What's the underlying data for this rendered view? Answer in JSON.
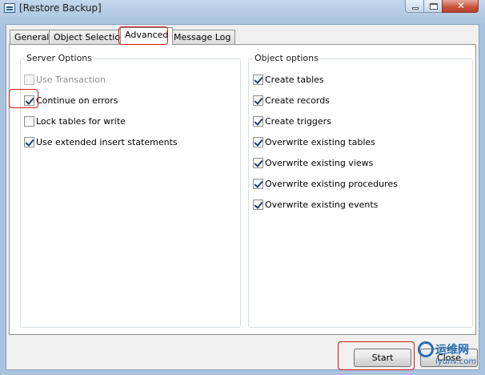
{
  "window": {
    "title": "[Restore Backup]",
    "close_glyph": "✕"
  },
  "tabs": [
    {
      "label": "General"
    },
    {
      "label": "Object Selection"
    },
    {
      "label": "Advanced"
    },
    {
      "label": "Message Log"
    }
  ],
  "server_options": {
    "title": "Server Options",
    "items": [
      {
        "label": "Use Transaction",
        "checked": false,
        "enabled": false
      },
      {
        "label": "Continue on errors",
        "checked": true,
        "enabled": true
      },
      {
        "label": "Lock tables for write",
        "checked": false,
        "enabled": true
      },
      {
        "label": "Use extended insert statements",
        "checked": true,
        "enabled": true
      }
    ]
  },
  "object_options": {
    "title": "Object options",
    "items": [
      {
        "label": "Create tables",
        "checked": true
      },
      {
        "label": "Create records",
        "checked": true
      },
      {
        "label": "Create triggers",
        "checked": true
      },
      {
        "label": "Overwrite existing tables",
        "checked": true
      },
      {
        "label": "Overwrite existing views",
        "checked": true
      },
      {
        "label": "Overwrite existing procedures",
        "checked": true
      },
      {
        "label": "Overwrite existing events",
        "checked": true
      }
    ]
  },
  "buttons": {
    "start": "Start",
    "close": "Close"
  },
  "watermark": {
    "cn": "运维网",
    "url": "iyunv.com"
  },
  "colors": {
    "highlight": "#d21818",
    "titlebar": "#a9c3de",
    "close_button": "#c9503b"
  }
}
